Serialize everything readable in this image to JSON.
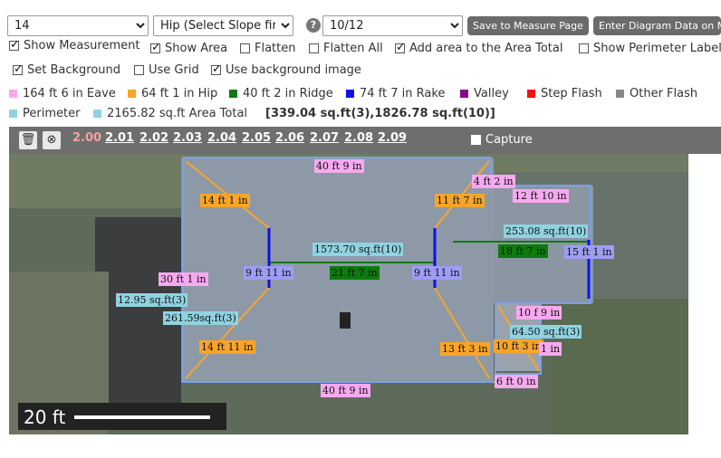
{
  "top": {
    "select1": "14",
    "select2": "Hip (Select Slope firs",
    "help": "?",
    "select3": "10/12",
    "save_btn": "Save to Measure Page",
    "enter_btn": "Enter Diagram Data on Measure"
  },
  "options": {
    "show_measurement": "Show Measurement",
    "show_area": "Show Area",
    "flatten": "Flatten",
    "flatten_all": "Flatten All",
    "add_area": "Add area to the Area Total",
    "show_perimeter": "Show Perimeter Labels",
    "set_background": "Set Background",
    "use_grid": "Use Grid",
    "use_bg_image": "Use background image"
  },
  "legend": {
    "eave": "164 ft 6 in Eave",
    "hip": "64 ft 1 in Hip",
    "ridge": "40 ft 2 in Ridge",
    "rake": "74 ft 7 in Rake",
    "valley": "Valley",
    "step": "Step Flash",
    "other": "Other Flash",
    "perimeter": "Perimeter",
    "area_total": "2165.82 sq.ft Area Total",
    "area_detail": "[339.04 sq.ft(3),1826.78 sq.ft(10)]",
    "colors": {
      "eave": "#f7a9f0",
      "hip": "#f7a52a",
      "ridge": "#0d7a0d",
      "rake": "#1010e0",
      "valley": "#8b0a8b",
      "step": "#ee1111",
      "other": "#888888",
      "perimeter": "#8fd3e0"
    }
  },
  "toolbar": {
    "versions": [
      "2.00",
      "2.01",
      "2.02",
      "2.03",
      "2.04",
      "2.05",
      "2.06",
      "2.07",
      "2.08",
      "2.09"
    ],
    "capture": "Capture"
  },
  "map": {
    "labels": [
      "40 ft 9 in",
      "14 ft 1 in",
      "11 ft 7 in",
      "4 ft 2 in",
      "12 ft 10 in",
      "253.08 sq.ft(10)",
      "1573.70 sq.ft(10)",
      "18 ft 7 in",
      "15 ft 1 in",
      "30 ft 1 in",
      "9 ft 11 in",
      "21 ft 7 in",
      "9 ft 11 in",
      "12.95 sq.ft(3)",
      "261.59sq.ft(3)",
      "10 f  9 in",
      "64.50  sq.ft(3)",
      "14 ft 11 in",
      "13 ft 3 in",
      "10 ft 3 in",
      "1 in",
      "40 ft 9 in",
      "6 ft 0 in"
    ],
    "scale": "20 ft"
  }
}
